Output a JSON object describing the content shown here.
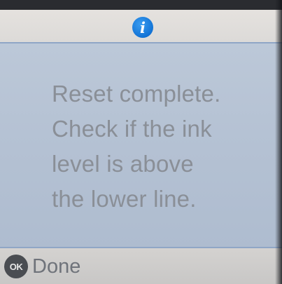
{
  "header": {
    "icon": "info-icon",
    "icon_glyph": "i",
    "icon_color": "#1273d6"
  },
  "message": {
    "lines": [
      "Reset complete.",
      "Check if the ink",
      "level is above",
      "the lower line."
    ]
  },
  "footer": {
    "button_icon": "ok-icon",
    "button_icon_label": "OK",
    "button_label": "Done"
  }
}
